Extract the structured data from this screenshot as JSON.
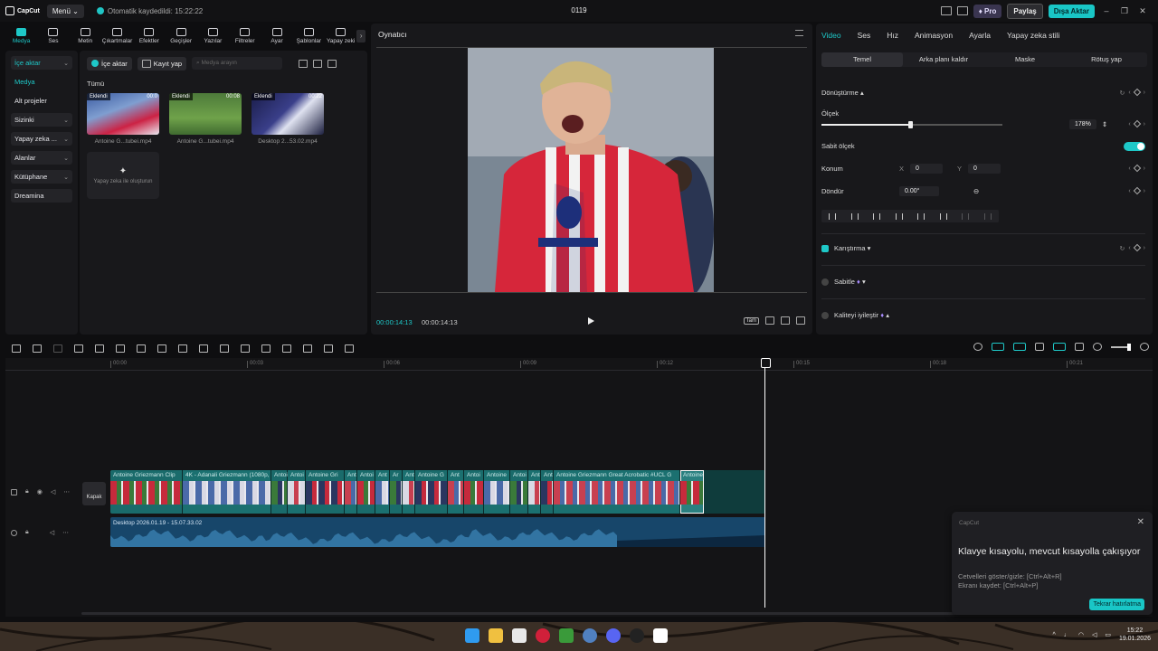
{
  "app": {
    "name": "CapCut",
    "menu_label": "Menü",
    "autosave": "Otomatik kaydedildi: 15:22:22",
    "project_title": "0119",
    "pro": "Pro",
    "share": "Paylaş",
    "export": "Dışa Aktar",
    "win_min": "–",
    "win_max": "❐",
    "win_close": "✕"
  },
  "toolbar": {
    "items": [
      "Medya",
      "Ses",
      "Metin",
      "Çıkartmalar",
      "Efektler",
      "Geçişler",
      "Yazılar",
      "Filtreler",
      "Ayar",
      "Şablonlar",
      "Yapay zeki"
    ],
    "more": "›"
  },
  "leftnav": {
    "items": [
      {
        "label": "İçe aktar",
        "chev": "⌄"
      },
      {
        "label": "Medya"
      },
      {
        "label": "Alt projeler"
      },
      {
        "label": "Sizinki",
        "chev": "⌄"
      },
      {
        "label": "Yapay zeka ...",
        "chev": "⌄"
      },
      {
        "label": "Alanlar",
        "chev": "⌄"
      },
      {
        "label": "Kütüphane",
        "chev": "⌄"
      },
      {
        "label": "Dreamina"
      }
    ]
  },
  "media": {
    "import": "İçe aktar",
    "record": "Kayıt yap",
    "search_placeholder": "Medya arayın",
    "all": "Tümü",
    "items": [
      {
        "tag": "Eklendi",
        "duration": "00:0",
        "name": "Antoine G...tubei.mp4"
      },
      {
        "tag": "Eklendi",
        "duration": "00:08",
        "name": "Antoine G...tubei.mp4"
      },
      {
        "tag": "Eklendi",
        "duration": "00:22",
        "name": "Desktop 2...53.02.mp4"
      }
    ],
    "ai_card": "Yapay zeka ile oluşturun"
  },
  "player": {
    "title": "Oynatıcı",
    "current": "00:00:14:13",
    "total": "00:00:14:13",
    "tam": "Tam"
  },
  "props": {
    "tabs": [
      "Video",
      "Ses",
      "Hız",
      "Animasyon",
      "Ayarla",
      "Yapay zeka stili"
    ],
    "subtabs": [
      "Temel",
      "Arka planı kaldır",
      "Maske",
      "Rötuş yap"
    ],
    "transform": "Dönüştürme",
    "scale_label": "Ölçek",
    "scale_value": "178%",
    "scale_level": 0.49,
    "uniform_scale": "Sabit ölçek",
    "position_label": "Konum",
    "x_label": "X",
    "x_value": "0",
    "y_label": "Y",
    "y_value": "0",
    "rotate_label": "Döndür",
    "rotate_value": "0.00°",
    "mix": "Karıştırma",
    "stabilize": "Sabitle",
    "enhance": "Kaliteyi iyileştir"
  },
  "timeline": {
    "ticks": [
      "00:00",
      "00:03",
      "00:06",
      "00:09",
      "00:12",
      "00:15",
      "00:18",
      "00:21"
    ],
    "cover": "Kapak",
    "clips": [
      {
        "title": "Antoine Griezmann Clip",
        "frac": 0.11,
        "color": "#1a6b6b"
      },
      {
        "title": "4K - Adanali Griezmann (1080p,",
        "frac": 0.135,
        "color": "#1b7070"
      },
      {
        "title": "Antoi",
        "frac": 0.025,
        "color": "#1a6b6b"
      },
      {
        "title": "Antoi",
        "frac": 0.028,
        "color": "#1b7070"
      },
      {
        "title": "Antoine Gri",
        "frac": 0.06,
        "color": "#1a6b6b"
      },
      {
        "title": "Ant",
        "frac": 0.02,
        "color": "#1b7070"
      },
      {
        "title": "Antoi",
        "frac": 0.028,
        "color": "#1a6b6b"
      },
      {
        "title": "Ant",
        "frac": 0.022,
        "color": "#1b7070"
      },
      {
        "title": "Ar",
        "frac": 0.02,
        "color": "#1a6b6b"
      },
      {
        "title": "Ant",
        "frac": 0.02,
        "color": "#1b7070"
      },
      {
        "title": "Antoine G",
        "frac": 0.05,
        "color": "#1a6b6b"
      },
      {
        "title": "Ant",
        "frac": 0.025,
        "color": "#1b7070"
      },
      {
        "title": "Antoi",
        "frac": 0.03,
        "color": "#1a6b6b"
      },
      {
        "title": "Antoine",
        "frac": 0.04,
        "color": "#1b7070"
      },
      {
        "title": "Antoi",
        "frac": 0.028,
        "color": "#1a6b6b"
      },
      {
        "title": "Ant",
        "frac": 0.02,
        "color": "#1b7070"
      },
      {
        "title": "Ant",
        "frac": 0.02,
        "color": "#1a6b6b"
      },
      {
        "title": "Antoine Griezmann Great Acrobatic #UCL G",
        "frac": 0.194,
        "color": "#1b7070"
      },
      {
        "title": "Antoine",
        "frac": 0.036,
        "color": "#2a8080"
      }
    ],
    "audio_title": "Desktop 2026.01.19 - 15.07.33.02"
  },
  "toast": {
    "app": "CapCut",
    "close": "✕",
    "title": "Klavye kısayolu, mevcut kısayolla çakışıyor",
    "line1": "Cetvelleri göster/gizle: [Ctrl+Alt+R]",
    "line2": "Ekranı kaydet: [Ctrl+Alt+P]",
    "button": "Tekrar hatırlatma"
  },
  "taskbar": {
    "time": "15:22",
    "date": "19.01.2026",
    "tray_chevron": "^"
  }
}
